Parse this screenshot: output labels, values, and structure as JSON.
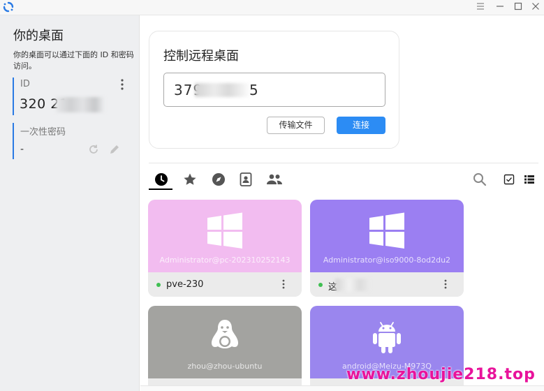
{
  "window": {
    "menu_icon": "hamburger-icon",
    "minimize_icon": "minimize-icon",
    "maximize_icon": "maximize-icon",
    "close_icon": "close-icon"
  },
  "sidebar": {
    "title": "你的桌面",
    "description": "你的桌面可以通过下面的 ID 和密码访问。",
    "id_label": "ID",
    "id_value": "320 21",
    "password_label": "一次性密码",
    "password_value": "-"
  },
  "connect": {
    "title": "控制远程桌面",
    "input_value": "379",
    "input_value_tail": "5",
    "transfer_button": "传输文件",
    "connect_button": "连接"
  },
  "tabs": [
    {
      "name": "recent",
      "icon": "clock-icon",
      "active": true
    },
    {
      "name": "favorites",
      "icon": "star-icon",
      "active": false
    },
    {
      "name": "discovered",
      "icon": "compass-icon",
      "active": false
    },
    {
      "name": "address-book",
      "icon": "address-book-icon",
      "active": false
    },
    {
      "name": "group",
      "icon": "group-icon",
      "active": false
    }
  ],
  "peers": [
    {
      "user": "Administrator@pc-202310252143",
      "name": "pve-230",
      "os": "windows",
      "color": "#f2bcf0",
      "online": true
    },
    {
      "user": "Administrator@iso9000-8od2du2",
      "name": "这",
      "os": "windows",
      "color": "#9b7ff2",
      "online": true
    },
    {
      "user": "zhou@zhou-ubuntu",
      "name": "",
      "os": "linux",
      "color": "#a3a3a0",
      "online": true
    },
    {
      "user": "android@Meizu-M973Q",
      "name": "",
      "os": "android",
      "color": "#9a86ee",
      "online": true
    }
  ],
  "colors": {
    "accent": "#2c8cf4",
    "sidebar_bg": "#eeeff1",
    "online": "#3fbf52"
  },
  "watermark": "www.zhoujie218.top"
}
